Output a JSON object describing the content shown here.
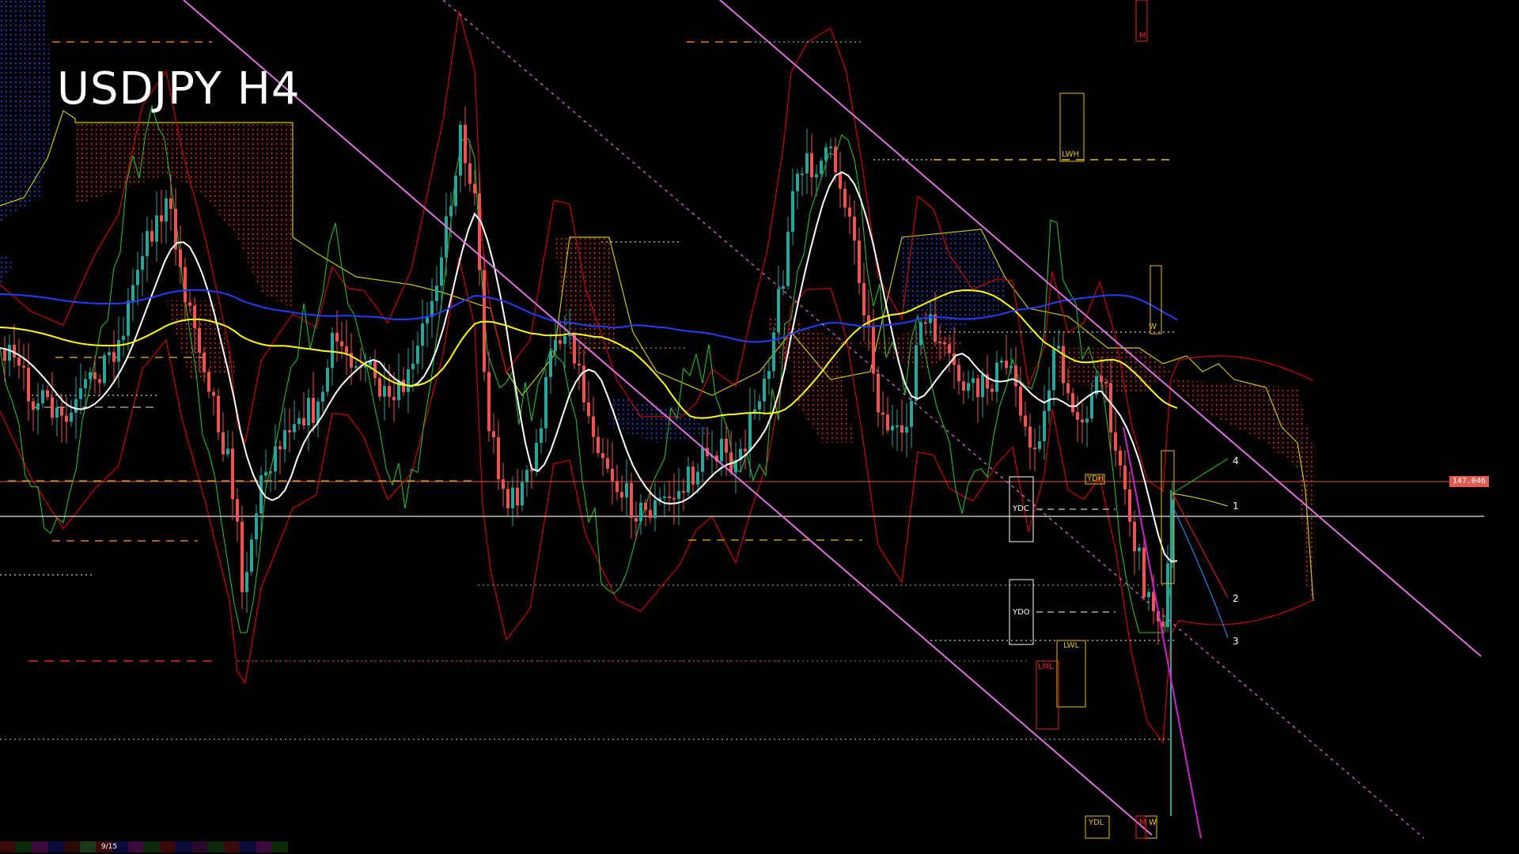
{
  "chart": {
    "symbol": "USDJPY",
    "timeframe": "H4",
    "title": "USDJPY H4",
    "current_price": "147.046"
  },
  "levels": {
    "ydc": "YDC",
    "ydo": "YDO",
    "ydh": "YDH",
    "ydl": "YDL",
    "lwh": "LWH",
    "lwl": "LWL",
    "lml": "LML",
    "w_top": "W",
    "w_bottom": "W",
    "m_top": "M",
    "m_bottom": "M"
  },
  "projections": [
    "4",
    "1",
    "2",
    "3"
  ],
  "status": {
    "page": "9/15"
  },
  "colors": {
    "background": "#000000",
    "bull_candle": "#26a69a",
    "bear_candle": "#ef5350",
    "channel": "#e070e0",
    "ma_white": "#ffffff",
    "ma_yellow": "#ffff00",
    "ma_blue": "#1f3fff",
    "bollinger": "#cc0000",
    "rsi_green": "#22cc22",
    "cloud_bear": "#ff2a1a",
    "cloud_bull": "#2255ff",
    "price_line": "#e05a4e"
  }
}
